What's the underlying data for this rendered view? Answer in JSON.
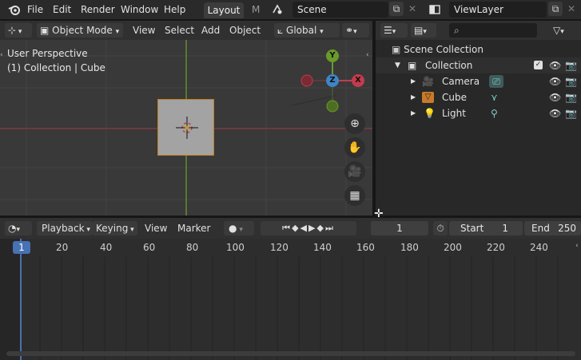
{
  "topbar": {
    "menus": [
      "File",
      "Edit",
      "Render",
      "Window",
      "Help"
    ],
    "active_tab": "Layout",
    "next_tab_fragment": "M",
    "scene": "Scene",
    "view_layer": "ViewLayer"
  },
  "viewport": {
    "mode": "Object Mode",
    "menus": [
      "View",
      "Select",
      "Add",
      "Object"
    ],
    "orientation": "Global",
    "info_line1": "User Perspective",
    "info_line2": "(1) Collection | Cube",
    "gizmo": {
      "y": "Y",
      "z": "Z",
      "x": "X"
    }
  },
  "outliner": {
    "scene_collection": "Scene Collection",
    "collection": "Collection",
    "objects": [
      "Camera",
      "Cube",
      "Light"
    ]
  },
  "timeline": {
    "menus": [
      "Playback",
      "Keying",
      "View",
      "Marker"
    ],
    "current_frame": "1",
    "start_label": "Start",
    "start_value": "1",
    "end_label": "End",
    "end_value": "250",
    "playhead": "1",
    "ticks": [
      "20",
      "40",
      "60",
      "80",
      "100",
      "120",
      "140",
      "160",
      "180",
      "200",
      "220",
      "240"
    ]
  },
  "colors": {
    "accent_blue": "#4772b3",
    "x_axis": "#c43b4c",
    "y_axis": "#6a9a2b",
    "z_axis": "#3d85c6"
  }
}
